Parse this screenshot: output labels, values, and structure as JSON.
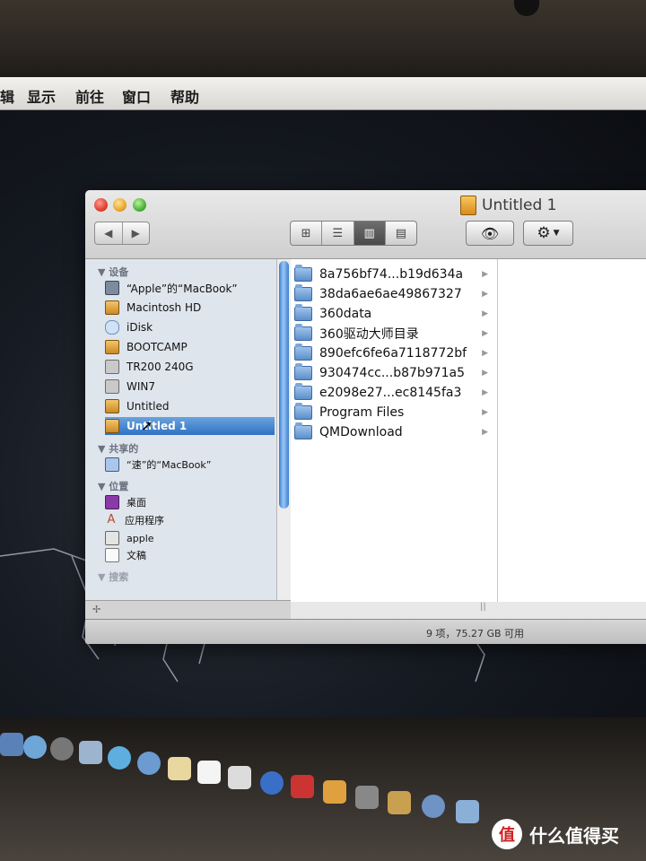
{
  "menubar": {
    "items": [
      "辑",
      "显示",
      "前往",
      "窗口",
      "帮助"
    ]
  },
  "window": {
    "title": "Untitled 1",
    "nav": {
      "back": "◀",
      "forward": "▶"
    },
    "view_buttons": [
      "icon",
      "list",
      "column",
      "cover-flow"
    ],
    "active_view": "column",
    "eye_icon": "eye-icon",
    "gear_icon": "gear-icon"
  },
  "sidebar": {
    "sections": [
      {
        "header": "设备",
        "items": [
          {
            "label": "“Apple”的“MacBook”",
            "icon": "laptop-icon"
          },
          {
            "label": "Macintosh HD",
            "icon": "harddrive-icon"
          },
          {
            "label": "iDisk",
            "icon": "idisk-icon"
          },
          {
            "label": "BOOTCAMP",
            "icon": "harddrive-icon"
          },
          {
            "label": "TR200 240G",
            "icon": "drive-icon"
          },
          {
            "label": "WIN7",
            "icon": "drive-icon"
          },
          {
            "label": "Untitled",
            "icon": "harddrive-icon"
          },
          {
            "label": "Untitled 1",
            "icon": "harddrive-icon",
            "selected": true
          }
        ]
      },
      {
        "header": "共享的",
        "items": [
          {
            "label": "“速”的“MacBook”",
            "icon": "network-computer-icon"
          }
        ]
      },
      {
        "header": "位置",
        "items": [
          {
            "label": "桌面",
            "icon": "desktop-icon"
          },
          {
            "label": "应用程序",
            "icon": "applications-icon"
          },
          {
            "label": "apple",
            "icon": "home-icon"
          },
          {
            "label": "文稿",
            "icon": "documents-icon"
          }
        ]
      },
      {
        "header": "搜索",
        "items": []
      }
    ]
  },
  "column": {
    "files": [
      "8a756bf74...b19d634a",
      "38da6ae6ae49867327",
      "360data",
      "360驱动大师目录",
      "890efc6fe6a7118772bf",
      "930474cc...b87b971a5",
      "e2098e27...ec8145fa3",
      "Program Files",
      "QMDownload"
    ]
  },
  "status": {
    "text": "9 项，75.27 GB 可用"
  },
  "watermark": {
    "badge": "值",
    "text": "什么值得买"
  }
}
